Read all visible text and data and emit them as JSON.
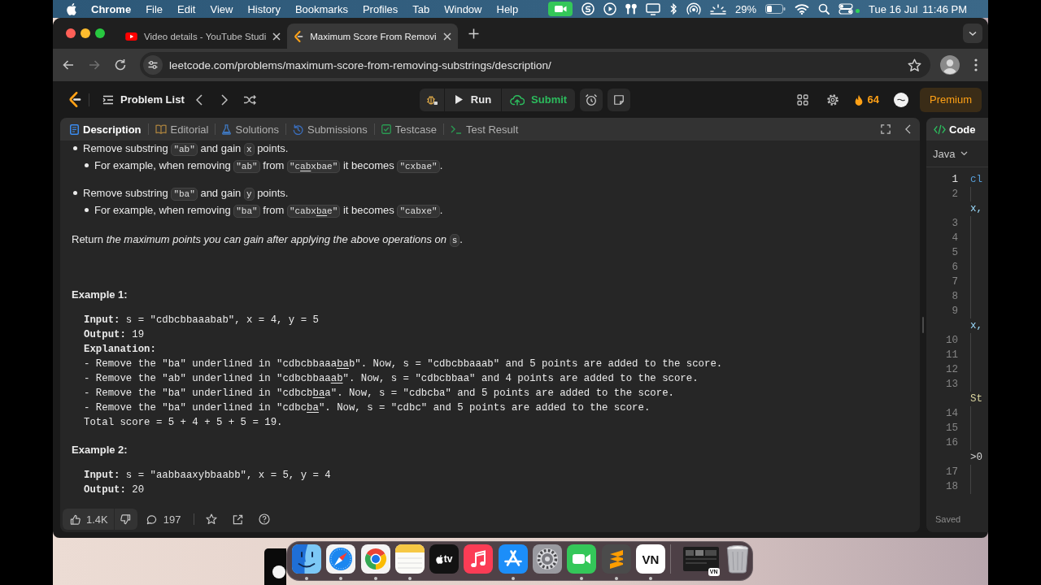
{
  "menu_bar": {
    "app_name": "Chrome",
    "menus": [
      "File",
      "Edit",
      "View",
      "History",
      "Bookmarks",
      "Profiles",
      "Tab",
      "Window",
      "Help"
    ],
    "battery": "29%",
    "date": "Tue 16 Jul",
    "time": "11:46 PM"
  },
  "browser": {
    "tabs": [
      {
        "kind": "video",
        "title": "Video details - YouTube Studi",
        "selected": false
      },
      {
        "kind": "code",
        "title": "Maximum Score From Removi",
        "selected": true
      }
    ],
    "url": "leetcode.com/problems/maximum-score-from-removing-substrings/description/"
  },
  "nav": {
    "problem_list": "Problem List",
    "run": "Run",
    "submit": "Submit",
    "streak": "64",
    "premium": "Premium"
  },
  "panel_tabs": [
    {
      "kind": "document",
      "label": "Description",
      "selected": true
    },
    {
      "kind": "book",
      "label": "Editorial",
      "selected": false
    },
    {
      "kind": "flask",
      "label": "Solutions",
      "selected": false
    },
    {
      "kind": "history",
      "label": "Submissions",
      "selected": false
    },
    {
      "kind": "checkbox",
      "label": "Testcase",
      "selected": false
    },
    {
      "kind": "terminal",
      "label": "Test Result",
      "selected": false
    }
  ],
  "description": {
    "bullets": [
      {
        "parts": [
          {
            "kind": "text",
            "text": "Remove substring "
          },
          {
            "kind": "code",
            "text": "\"ab\""
          },
          {
            "kind": "text",
            "text": " and gain "
          },
          {
            "kind": "code",
            "text": "x"
          },
          {
            "kind": "text",
            "text": " points."
          }
        ],
        "children": [
          {
            "parts": [
              {
                "kind": "text",
                "text": "For example, when removing "
              },
              {
                "kind": "code",
                "text": "\"ab\""
              },
              {
                "kind": "text",
                "text": " from "
              },
              {
                "kind": "code",
                "segments": [
                  {
                    "text": "\"c",
                    "underlined": false
                  },
                  {
                    "text": "ab",
                    "underlined": true
                  },
                  {
                    "text": "xbae\"",
                    "underlined": false
                  }
                ]
              },
              {
                "kind": "text",
                "text": " it becomes "
              },
              {
                "kind": "code",
                "text": "\"cxbae\""
              },
              {
                "kind": "text",
                "text": "."
              }
            ]
          }
        ]
      },
      {
        "parts": [
          {
            "kind": "text",
            "text": "Remove substring "
          },
          {
            "kind": "code",
            "text": "\"ba\""
          },
          {
            "kind": "text",
            "text": " and gain "
          },
          {
            "kind": "code",
            "text": "y"
          },
          {
            "kind": "text",
            "text": " points."
          }
        ],
        "children": [
          {
            "parts": [
              {
                "kind": "text",
                "text": "For example, when removing "
              },
              {
                "kind": "code",
                "text": "\"ba\""
              },
              {
                "kind": "text",
                "text": " from "
              },
              {
                "kind": "code",
                "segments": [
                  {
                    "text": "\"cabx",
                    "underlined": false
                  },
                  {
                    "text": "ba",
                    "underlined": true
                  },
                  {
                    "text": "e\"",
                    "underlined": false
                  }
                ]
              },
              {
                "kind": "text",
                "text": " it becomes "
              },
              {
                "kind": "code",
                "text": "\"cabxe\""
              },
              {
                "kind": "text",
                "text": "."
              }
            ]
          }
        ]
      }
    ],
    "return_text": {
      "parts": [
        {
          "kind": "text",
          "text": "Return *the maximum points you can gain after applying the above operations on* "
        },
        {
          "kind": "code",
          "text": "s"
        },
        {
          "kind": "text",
          "text": "."
        }
      ]
    },
    "examples": [
      {
        "title": "Example 1:",
        "lines": [
          {
            "kind": "text",
            "text": "**Input:** s = \"cdbcbbaaabab\", x = 4, y = 5"
          },
          {
            "kind": "text",
            "text": "**Output:** 19"
          },
          {
            "kind": "label",
            "text": "Explanation:"
          },
          {
            "kind": "mixed",
            "segments": [
              {
                "text": "- Remove the \"ba\" underlined in \"cdbcbbaaa",
                "underlined": false
              },
              {
                "text": "ba",
                "underlined": true
              },
              {
                "text": "b\". Now, s = \"cdbcbbaaab\" and 5 points are added to the score.",
                "underlined": false
              }
            ]
          },
          {
            "kind": "mixed",
            "segments": [
              {
                "text": "- Remove the \"ab\" underlined in \"cdbcbbaa",
                "underlined": false
              },
              {
                "text": "ab",
                "underlined": true
              },
              {
                "text": "\". Now, s = \"cdbcbbaa\" and 4 points are added to the score.",
                "underlined": false
              }
            ]
          },
          {
            "kind": "mixed",
            "segments": [
              {
                "text": "- Remove the \"ba\" underlined in \"cdbcb",
                "underlined": false
              },
              {
                "text": "ba",
                "underlined": true
              },
              {
                "text": "a\". Now, s = \"cdbcba\" and 5 points are added to the score.",
                "underlined": false
              }
            ]
          },
          {
            "kind": "mixed",
            "segments": [
              {
                "text": "- Remove the \"ba\" underlined in \"cdbc",
                "underlined": false
              },
              {
                "text": "ba",
                "underlined": true
              },
              {
                "text": "\". Now, s = \"cdbc\" and 5 points are added to the score.",
                "underlined": false
              }
            ]
          },
          {
            "kind": "text",
            "text": "Total score = 5 + 4 + 5 + 5 = 19."
          }
        ]
      },
      {
        "title": "Example 2:",
        "lines": [
          {
            "kind": "text",
            "text": "**Input:** s = \"aabbaaxybbaabb\", x = 5, y = 4"
          },
          {
            "kind": "text",
            "text": "**Output:** 20"
          }
        ]
      }
    ]
  },
  "footer": {
    "likes": "1.4K",
    "comments": "197"
  },
  "code_panel": {
    "title": "Code",
    "language": "Java",
    "lines": [
      {
        "number": "1",
        "current": true,
        "code": "cl",
        "kind": "keyword"
      },
      {
        "number": "2",
        "current": false
      },
      {
        "code": "x,",
        "kind": "variable"
      },
      {
        "number": "3",
        "current": false
      },
      {
        "number": "4",
        "current": false
      },
      {
        "number": "5",
        "current": false
      },
      {
        "number": "6",
        "current": false
      },
      {
        "number": "7",
        "current": false
      },
      {
        "number": "8",
        "current": false
      },
      {
        "number": "9",
        "current": false
      },
      {
        "code": "x,",
        "kind": "variable"
      },
      {
        "number": "10",
        "current": false
      },
      {
        "number": "11",
        "current": false
      },
      {
        "number": "12",
        "current": false
      },
      {
        "number": "13",
        "current": false
      },
      {
        "code": "St",
        "kind": "type"
      },
      {
        "number": "14",
        "current": false
      },
      {
        "number": "15",
        "current": false
      },
      {
        "number": "16",
        "current": false
      },
      {
        "code": ">0",
        "kind": "plain"
      },
      {
        "number": "17",
        "current": false
      },
      {
        "number": "18",
        "current": false
      }
    ],
    "status": "Saved"
  },
  "dock": {
    "items": [
      {
        "kind": "face",
        "running": true
      },
      {
        "kind": "compass",
        "running": true
      },
      {
        "kind": "wheel",
        "running": true
      },
      {
        "kind": "notepad",
        "running": true
      },
      {
        "kind": "tv",
        "label": "tv",
        "running": false
      },
      {
        "kind": "note",
        "running": false
      },
      {
        "kind": "strokes",
        "running": true
      },
      {
        "kind": "gear",
        "running": false
      },
      {
        "kind": "camera",
        "running": true
      },
      {
        "kind": "ribbon",
        "running": true
      },
      {
        "kind": "letters",
        "label": "VN",
        "running": true
      }
    ],
    "minimized_window": {
      "badge": "VN"
    }
  }
}
